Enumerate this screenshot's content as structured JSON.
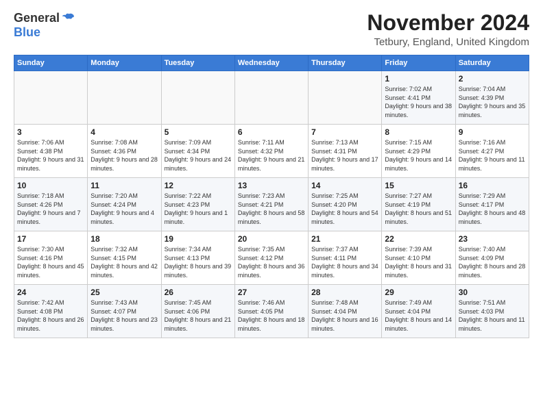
{
  "header": {
    "logo_general": "General",
    "logo_blue": "Blue",
    "month_title": "November 2024",
    "location": "Tetbury, England, United Kingdom"
  },
  "columns": [
    "Sunday",
    "Monday",
    "Tuesday",
    "Wednesday",
    "Thursday",
    "Friday",
    "Saturday"
  ],
  "weeks": [
    [
      {
        "day": "",
        "sunrise": "",
        "sunset": "",
        "daylight": ""
      },
      {
        "day": "",
        "sunrise": "",
        "sunset": "",
        "daylight": ""
      },
      {
        "day": "",
        "sunrise": "",
        "sunset": "",
        "daylight": ""
      },
      {
        "day": "",
        "sunrise": "",
        "sunset": "",
        "daylight": ""
      },
      {
        "day": "",
        "sunrise": "",
        "sunset": "",
        "daylight": ""
      },
      {
        "day": "1",
        "sunrise": "Sunrise: 7:02 AM",
        "sunset": "Sunset: 4:41 PM",
        "daylight": "Daylight: 9 hours and 38 minutes."
      },
      {
        "day": "2",
        "sunrise": "Sunrise: 7:04 AM",
        "sunset": "Sunset: 4:39 PM",
        "daylight": "Daylight: 9 hours and 35 minutes."
      }
    ],
    [
      {
        "day": "3",
        "sunrise": "Sunrise: 7:06 AM",
        "sunset": "Sunset: 4:38 PM",
        "daylight": "Daylight: 9 hours and 31 minutes."
      },
      {
        "day": "4",
        "sunrise": "Sunrise: 7:08 AM",
        "sunset": "Sunset: 4:36 PM",
        "daylight": "Daylight: 9 hours and 28 minutes."
      },
      {
        "day": "5",
        "sunrise": "Sunrise: 7:09 AM",
        "sunset": "Sunset: 4:34 PM",
        "daylight": "Daylight: 9 hours and 24 minutes."
      },
      {
        "day": "6",
        "sunrise": "Sunrise: 7:11 AM",
        "sunset": "Sunset: 4:32 PM",
        "daylight": "Daylight: 9 hours and 21 minutes."
      },
      {
        "day": "7",
        "sunrise": "Sunrise: 7:13 AM",
        "sunset": "Sunset: 4:31 PM",
        "daylight": "Daylight: 9 hours and 17 minutes."
      },
      {
        "day": "8",
        "sunrise": "Sunrise: 7:15 AM",
        "sunset": "Sunset: 4:29 PM",
        "daylight": "Daylight: 9 hours and 14 minutes."
      },
      {
        "day": "9",
        "sunrise": "Sunrise: 7:16 AM",
        "sunset": "Sunset: 4:27 PM",
        "daylight": "Daylight: 9 hours and 11 minutes."
      }
    ],
    [
      {
        "day": "10",
        "sunrise": "Sunrise: 7:18 AM",
        "sunset": "Sunset: 4:26 PM",
        "daylight": "Daylight: 9 hours and 7 minutes."
      },
      {
        "day": "11",
        "sunrise": "Sunrise: 7:20 AM",
        "sunset": "Sunset: 4:24 PM",
        "daylight": "Daylight: 9 hours and 4 minutes."
      },
      {
        "day": "12",
        "sunrise": "Sunrise: 7:22 AM",
        "sunset": "Sunset: 4:23 PM",
        "daylight": "Daylight: 9 hours and 1 minute."
      },
      {
        "day": "13",
        "sunrise": "Sunrise: 7:23 AM",
        "sunset": "Sunset: 4:21 PM",
        "daylight": "Daylight: 8 hours and 58 minutes."
      },
      {
        "day": "14",
        "sunrise": "Sunrise: 7:25 AM",
        "sunset": "Sunset: 4:20 PM",
        "daylight": "Daylight: 8 hours and 54 minutes."
      },
      {
        "day": "15",
        "sunrise": "Sunrise: 7:27 AM",
        "sunset": "Sunset: 4:19 PM",
        "daylight": "Daylight: 8 hours and 51 minutes."
      },
      {
        "day": "16",
        "sunrise": "Sunrise: 7:29 AM",
        "sunset": "Sunset: 4:17 PM",
        "daylight": "Daylight: 8 hours and 48 minutes."
      }
    ],
    [
      {
        "day": "17",
        "sunrise": "Sunrise: 7:30 AM",
        "sunset": "Sunset: 4:16 PM",
        "daylight": "Daylight: 8 hours and 45 minutes."
      },
      {
        "day": "18",
        "sunrise": "Sunrise: 7:32 AM",
        "sunset": "Sunset: 4:15 PM",
        "daylight": "Daylight: 8 hours and 42 minutes."
      },
      {
        "day": "19",
        "sunrise": "Sunrise: 7:34 AM",
        "sunset": "Sunset: 4:13 PM",
        "daylight": "Daylight: 8 hours and 39 minutes."
      },
      {
        "day": "20",
        "sunrise": "Sunrise: 7:35 AM",
        "sunset": "Sunset: 4:12 PM",
        "daylight": "Daylight: 8 hours and 36 minutes."
      },
      {
        "day": "21",
        "sunrise": "Sunrise: 7:37 AM",
        "sunset": "Sunset: 4:11 PM",
        "daylight": "Daylight: 8 hours and 34 minutes."
      },
      {
        "day": "22",
        "sunrise": "Sunrise: 7:39 AM",
        "sunset": "Sunset: 4:10 PM",
        "daylight": "Daylight: 8 hours and 31 minutes."
      },
      {
        "day": "23",
        "sunrise": "Sunrise: 7:40 AM",
        "sunset": "Sunset: 4:09 PM",
        "daylight": "Daylight: 8 hours and 28 minutes."
      }
    ],
    [
      {
        "day": "24",
        "sunrise": "Sunrise: 7:42 AM",
        "sunset": "Sunset: 4:08 PM",
        "daylight": "Daylight: 8 hours and 26 minutes."
      },
      {
        "day": "25",
        "sunrise": "Sunrise: 7:43 AM",
        "sunset": "Sunset: 4:07 PM",
        "daylight": "Daylight: 8 hours and 23 minutes."
      },
      {
        "day": "26",
        "sunrise": "Sunrise: 7:45 AM",
        "sunset": "Sunset: 4:06 PM",
        "daylight": "Daylight: 8 hours and 21 minutes."
      },
      {
        "day": "27",
        "sunrise": "Sunrise: 7:46 AM",
        "sunset": "Sunset: 4:05 PM",
        "daylight": "Daylight: 8 hours and 18 minutes."
      },
      {
        "day": "28",
        "sunrise": "Sunrise: 7:48 AM",
        "sunset": "Sunset: 4:04 PM",
        "daylight": "Daylight: 8 hours and 16 minutes."
      },
      {
        "day": "29",
        "sunrise": "Sunrise: 7:49 AM",
        "sunset": "Sunset: 4:04 PM",
        "daylight": "Daylight: 8 hours and 14 minutes."
      },
      {
        "day": "30",
        "sunrise": "Sunrise: 7:51 AM",
        "sunset": "Sunset: 4:03 PM",
        "daylight": "Daylight: 8 hours and 11 minutes."
      }
    ]
  ]
}
